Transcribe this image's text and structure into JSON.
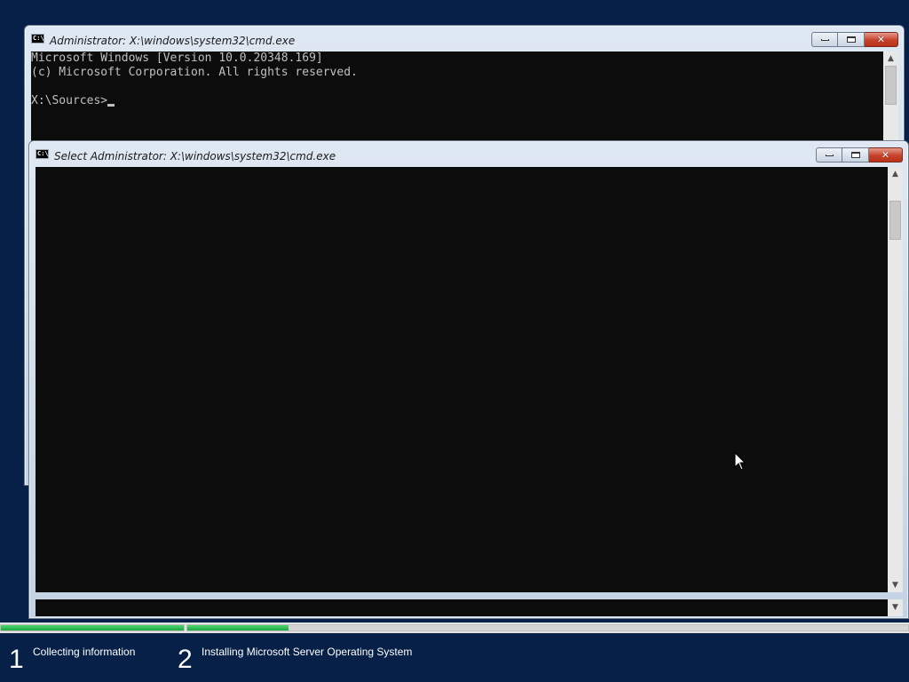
{
  "background_color": "#062048",
  "window_back": {
    "title": "Administrator: X:\\windows\\system32\\cmd.exe",
    "icon_text": "C:\\",
    "console_lines": [
      "Microsoft Windows [Version 10.0.20348.169]",
      "(c) Microsoft Corporation. All rights reserved.",
      "",
      "X:\\Sources>"
    ]
  },
  "window_front": {
    "title": "Select Administrator: X:\\windows\\system32\\cmd.exe",
    "icon_text": "C:\\",
    "console_lines": []
  },
  "setup": {
    "progress_colors": {
      "fill": "#1fa745",
      "track": "#e4e4e4"
    },
    "step1": {
      "number": "1",
      "label": "Collecting information",
      "progress": 1.0
    },
    "step2": {
      "number": "2",
      "label": "Installing Microsoft Server Operating System",
      "progress": 0.14
    }
  }
}
